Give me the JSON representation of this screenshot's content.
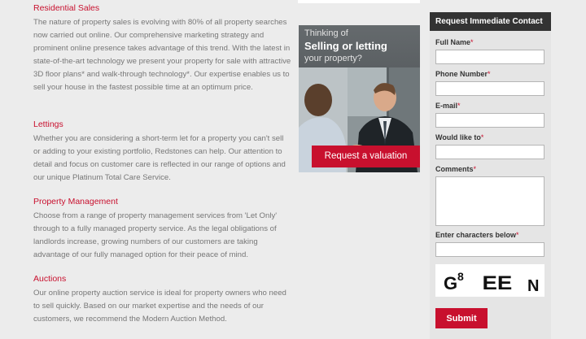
{
  "sections": [
    {
      "title": "Residential Sales",
      "body": "The nature of property sales is evolving with 80% of all property searches now carried out online. Our comprehensive marketing strategy and prominent online presence takes advantage of this trend. With the latest in state-of-the-art technology we present your property for sale with attractive 3D floor plans* and walk-through technology*. Our expertise enables us to sell your house in the fastest possible time at an optimum price."
    },
    {
      "title": "Lettings",
      "body": "Whether you are considering a short-term let for a property you can't sell or adding to your existing portfolio, Redstones can help. Our attention to detail and focus on customer care is reflected in our range of options and our unique Platinum Total Care Service."
    },
    {
      "title": "Property Management",
      "body": "Choose from a range of property management services from 'Let Only' through to a fully managed property service.  As the legal obligations of landlords increase, growing numbers of our customers are taking advantage of our fully managed option for their peace of mind."
    },
    {
      "title": "Auctions",
      "body": "Our online property auction service is ideal for property owners who need to sell quickly. Based on our market expertise and the needs of our customers, we recommend the Modern Auction Method."
    }
  ],
  "promo": {
    "line1": "Thinking of",
    "line2": "Selling or letting",
    "line3": "your property?",
    "cta": "Request a valuation"
  },
  "form": {
    "title": "Request Immediate Contact",
    "required_mark": "*",
    "fields": {
      "full_name": "Full Name",
      "phone": "Phone Number",
      "email": "E-mail",
      "would_like": "Would like to",
      "comments": "Comments",
      "captcha_label": "Enter characters below"
    },
    "captcha_text": "G8 EEN",
    "submit": "Submit"
  },
  "colors": {
    "accent": "#c8102e",
    "header_dark": "#333333",
    "body_text": "#777777"
  }
}
